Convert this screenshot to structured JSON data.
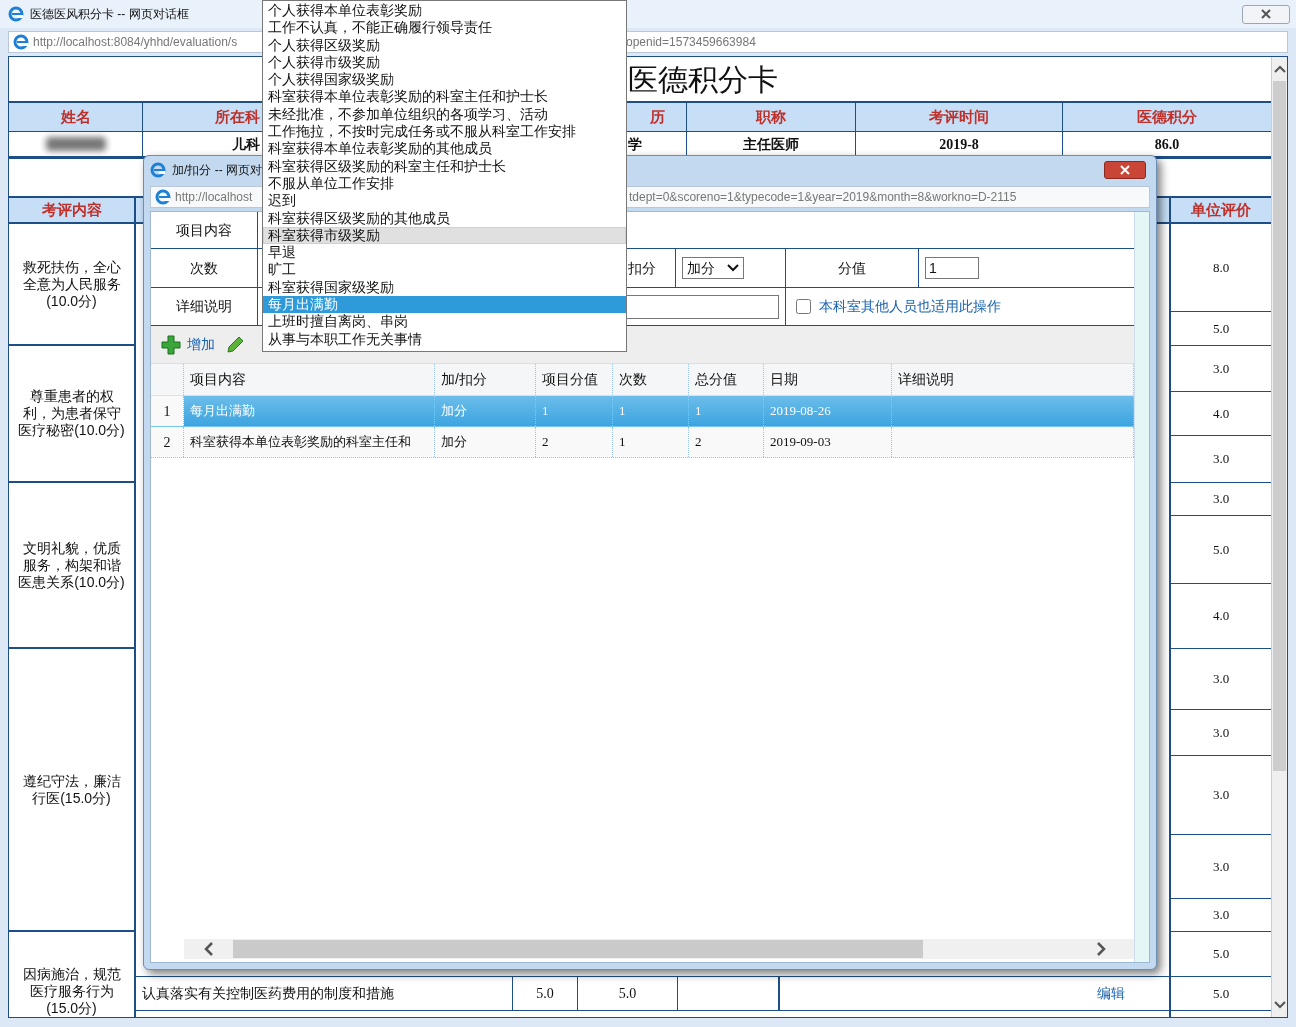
{
  "window": {
    "title": "医德医风积分卡 -- 网页对话框",
    "address_left": "http://localhost:8084/yhhd/evaluation/s",
    "address_right": "openid=1573459663984"
  },
  "card": {
    "title": "医德积分卡",
    "columns": [
      {
        "label": "姓名",
        "blurred_value": true
      },
      {
        "label": "所在科",
        "value": "儿科"
      },
      {
        "label": "历",
        "value": "学"
      },
      {
        "label": "职称",
        "value": "主任医师"
      },
      {
        "label": "考评时间",
        "value": "2019-8"
      },
      {
        "label": "医德积分",
        "value": "86.0"
      }
    ],
    "section_left": "考评内容",
    "section_right": "单位评价",
    "categories": [
      "救死扶伤，全心全意为人民服务(10.0分)",
      "尊重患者的权利，为患者保守医疗秘密(10.0分)",
      "文明礼貌，优质服务，构架和谐医患关系(10.0分)",
      "遵纪守法，廉洁行医(15.0分)",
      "因病施治，规范医疗服务行为(15.0分)"
    ],
    "unit_scores": [
      "8.0",
      "5.0",
      "3.0",
      "4.0",
      "3.0",
      "3.0",
      "5.0",
      "4.0",
      "3.0",
      "3.0",
      "3.0",
      "3.0",
      "3.0",
      "5.0",
      "5.0"
    ],
    "bottom_row": {
      "item": "认真落实有关控制医药费用的制度和措施",
      "score": "5.0",
      "value": "5.0",
      "action": "编辑"
    }
  },
  "dialog": {
    "title": "加/扣分 -- 网页对",
    "address_left": "http://localhost",
    "address_right": "tdept=0&scoreno=1&typecode=1&year=2019&month=8&workno=D-2115",
    "form": {
      "item_label": "项目内容",
      "count_label": "次数",
      "detail_label": "详细说明",
      "type_label": "扣分",
      "type_value": "加分",
      "value_label": "分值",
      "value_input": "1",
      "apply_all": {
        "label": "本科室其他人员也适用此操作",
        "checked": false
      }
    },
    "toolbar": [
      {
        "kind": "add",
        "label": "增加"
      },
      {
        "kind": "edit"
      }
    ],
    "grid": {
      "columns": [
        "项目内容",
        "加/扣分",
        "项目分值",
        "次数",
        "总分值",
        "日期",
        "详细说明"
      ],
      "rows": [
        {
          "number": "1",
          "selected": true,
          "cells": [
            "每月出满勤",
            "加分",
            "1",
            "1",
            "1",
            "2019-08-26",
            ""
          ]
        },
        {
          "number": "2",
          "selected": false,
          "cells": [
            "科室获得本单位表彰奖励的科室主任和",
            "加分",
            "2",
            "1",
            "2",
            "2019-09-03",
            ""
          ]
        }
      ]
    }
  },
  "dropdown": {
    "items": [
      {
        "label": "个人获得本单位表彰奖励",
        "selected": false,
        "hovered": false
      },
      {
        "label": "工作不认真，不能正确履行领导责任",
        "selected": false,
        "hovered": false
      },
      {
        "label": "个人获得区级奖励",
        "selected": false,
        "hovered": false
      },
      {
        "label": "个人获得市级奖励",
        "selected": false,
        "hovered": false
      },
      {
        "label": "个人获得国家级奖励",
        "selected": false,
        "hovered": false
      },
      {
        "label": "科室获得本单位表彰奖励的科室主任和护士长",
        "selected": false,
        "hovered": false
      },
      {
        "label": "未经批准，不参加单位组织的各项学习、活动",
        "selected": false,
        "hovered": false
      },
      {
        "label": "工作拖拉，不按时完成任务或不服从科室工作安排",
        "selected": false,
        "hovered": false
      },
      {
        "label": "科室获得本单位表彰奖励的其他成员",
        "selected": false,
        "hovered": false
      },
      {
        "label": "科室获得区级奖励的科室主任和护士长",
        "selected": false,
        "hovered": false
      },
      {
        "label": "不服从单位工作安排",
        "selected": false,
        "hovered": false
      },
      {
        "label": "迟到",
        "selected": false,
        "hovered": false
      },
      {
        "label": "科室获得区级奖励的其他成员",
        "selected": false,
        "hovered": false
      },
      {
        "label": "科室获得市级奖励",
        "selected": false,
        "hovered": true
      },
      {
        "label": "早退",
        "selected": false,
        "hovered": false
      },
      {
        "label": "旷工",
        "selected": false,
        "hovered": false
      },
      {
        "label": "科室获得国家级奖励",
        "selected": false,
        "hovered": false
      },
      {
        "label": "每月出满勤",
        "selected": true,
        "hovered": false
      },
      {
        "label": "上班时擅自离岗、串岗",
        "selected": false,
        "hovered": false
      },
      {
        "label": "从事与本职工作无关事情",
        "selected": false,
        "hovered": false
      }
    ]
  }
}
